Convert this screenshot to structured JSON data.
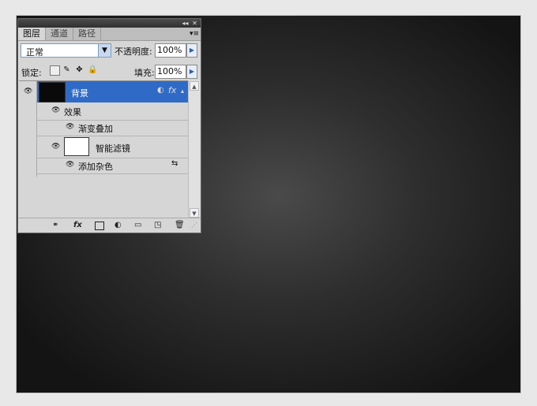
{
  "panel": {
    "tabs": [
      {
        "label": "图层",
        "active": true
      },
      {
        "label": "通道",
        "active": false
      },
      {
        "label": "路径",
        "active": false
      }
    ],
    "blend_mode": "正常",
    "opacity_label": "不透明度:",
    "opacity_value": "100%",
    "lock_label": "锁定:",
    "fill_label": "填充:",
    "fill_value": "100%"
  },
  "layers": {
    "background": {
      "name": "背景"
    },
    "effects_label": "效果",
    "gradient_overlay": "渐变叠加",
    "smart_filters": "智能滤镜",
    "add_noise": "添加杂色"
  },
  "colors": {
    "selection": "#2f6bc6",
    "panel_bg": "#d6d6d6",
    "canvas_center": "#4a4a4a",
    "canvas_edge": "#141414"
  }
}
